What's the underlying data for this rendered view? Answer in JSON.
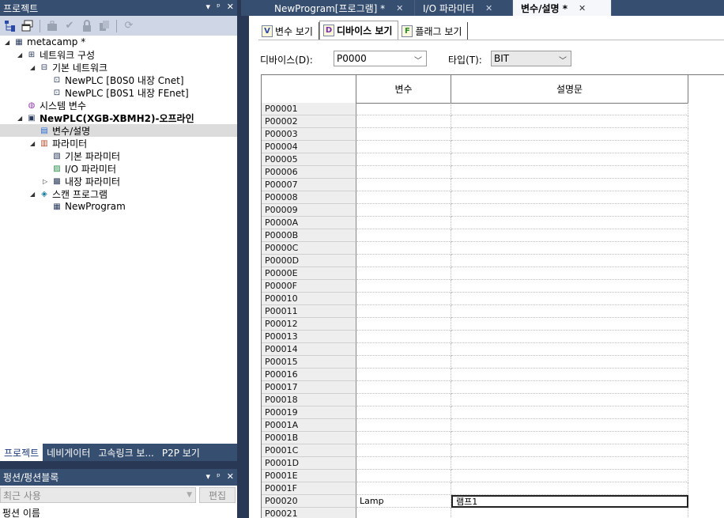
{
  "project_panel": {
    "title": "프로젝트",
    "controls": [
      "▾",
      "ᵖ",
      "✕"
    ],
    "tree": [
      {
        "label": "metacamp *",
        "level": 0,
        "expander": "◢",
        "icon": "project-icon"
      },
      {
        "label": "네트워크 구성",
        "level": 1,
        "expander": "◢",
        "icon": "network-config-icon"
      },
      {
        "label": "기본 네트워크",
        "level": 2,
        "expander": "◢",
        "icon": "network-icon"
      },
      {
        "label": "NewPLC [B0S0 내장 Cnet]",
        "level": 3,
        "expander": "",
        "icon": "cnet-icon"
      },
      {
        "label": "NewPLC [B0S1 내장 FEnet]",
        "level": 3,
        "expander": "",
        "icon": "fenet-icon"
      },
      {
        "label": "시스템 변수",
        "level": 1,
        "expander": "",
        "icon": "system-variable-icon"
      },
      {
        "label": "NewPLC(XGB-XBMH2)-오프라인",
        "level": 1,
        "expander": "◢",
        "icon": "plc-icon",
        "bold": true
      },
      {
        "label": "변수/설명",
        "level": 2,
        "expander": "",
        "icon": "variable-icon",
        "selected": true
      },
      {
        "label": "파라미터",
        "level": 2,
        "expander": "◢",
        "icon": "parameter-icon"
      },
      {
        "label": "기본 파라미터",
        "level": 3,
        "expander": "",
        "icon": "basic-parameter-icon"
      },
      {
        "label": "I/O 파라미터",
        "level": 3,
        "expander": "",
        "icon": "io-parameter-icon"
      },
      {
        "label": "내장 파라미터",
        "level": 3,
        "expander": "▷",
        "icon": "builtin-parameter-icon"
      },
      {
        "label": "스캔 프로그램",
        "level": 2,
        "expander": "◢",
        "icon": "scan-program-icon"
      },
      {
        "label": "NewProgram",
        "level": 3,
        "expander": "",
        "icon": "program-icon"
      }
    ],
    "bottom_tabs": [
      "프로젝트",
      "네비게이터",
      "고속링크 보...",
      "P2P 보기"
    ]
  },
  "function_panel": {
    "title": "펑션/펑션블록",
    "controls": [
      "▾",
      "ᵖ",
      "✕"
    ],
    "recent_placeholder": "최근 사용",
    "edit_label": "편집",
    "list_header": "펑션 이름"
  },
  "doc_tabs": [
    {
      "label": "NewProgram[프로그램] *",
      "close": "✕",
      "active": false
    },
    {
      "label": "I/O 파라미터",
      "close": "✕",
      "active": false
    },
    {
      "label": "변수/설명 *",
      "close": "✕",
      "active": true
    }
  ],
  "view_tabs": [
    {
      "label": "변수 보기",
      "icon": "V",
      "active": false
    },
    {
      "label": "디바이스 보기",
      "icon": "D",
      "active": true
    },
    {
      "label": "플래그 보기",
      "icon": "F",
      "active": false
    }
  ],
  "filters": {
    "device_label": "디바이스(D):",
    "device_value": "P0000",
    "type_label": "타입(T):",
    "type_value": "BIT"
  },
  "grid": {
    "columns": [
      "",
      "변수",
      "설명문"
    ],
    "rows": [
      {
        "device": "P00001",
        "variable": "",
        "comment": ""
      },
      {
        "device": "P00002",
        "variable": "",
        "comment": ""
      },
      {
        "device": "P00003",
        "variable": "",
        "comment": ""
      },
      {
        "device": "P00004",
        "variable": "",
        "comment": ""
      },
      {
        "device": "P00005",
        "variable": "",
        "comment": ""
      },
      {
        "device": "P00006",
        "variable": "",
        "comment": ""
      },
      {
        "device": "P00007",
        "variable": "",
        "comment": ""
      },
      {
        "device": "P00008",
        "variable": "",
        "comment": ""
      },
      {
        "device": "P00009",
        "variable": "",
        "comment": ""
      },
      {
        "device": "P0000A",
        "variable": "",
        "comment": ""
      },
      {
        "device": "P0000B",
        "variable": "",
        "comment": ""
      },
      {
        "device": "P0000C",
        "variable": "",
        "comment": ""
      },
      {
        "device": "P0000D",
        "variable": "",
        "comment": ""
      },
      {
        "device": "P0000E",
        "variable": "",
        "comment": ""
      },
      {
        "device": "P0000F",
        "variable": "",
        "comment": ""
      },
      {
        "device": "P00010",
        "variable": "",
        "comment": ""
      },
      {
        "device": "P00011",
        "variable": "",
        "comment": ""
      },
      {
        "device": "P00012",
        "variable": "",
        "comment": ""
      },
      {
        "device": "P00013",
        "variable": "",
        "comment": ""
      },
      {
        "device": "P00014",
        "variable": "",
        "comment": ""
      },
      {
        "device": "P00015",
        "variable": "",
        "comment": ""
      },
      {
        "device": "P00016",
        "variable": "",
        "comment": ""
      },
      {
        "device": "P00017",
        "variable": "",
        "comment": ""
      },
      {
        "device": "P00018",
        "variable": "",
        "comment": ""
      },
      {
        "device": "P00019",
        "variable": "",
        "comment": ""
      },
      {
        "device": "P0001A",
        "variable": "",
        "comment": ""
      },
      {
        "device": "P0001B",
        "variable": "",
        "comment": ""
      },
      {
        "device": "P0001C",
        "variable": "",
        "comment": ""
      },
      {
        "device": "P0001D",
        "variable": "",
        "comment": ""
      },
      {
        "device": "P0001E",
        "variable": "",
        "comment": ""
      },
      {
        "device": "P0001F",
        "variable": "",
        "comment": ""
      },
      {
        "device": "P00020",
        "variable": "Lamp",
        "comment": "램프1",
        "editing": true
      },
      {
        "device": "P00021",
        "variable": "",
        "comment": ""
      }
    ]
  }
}
